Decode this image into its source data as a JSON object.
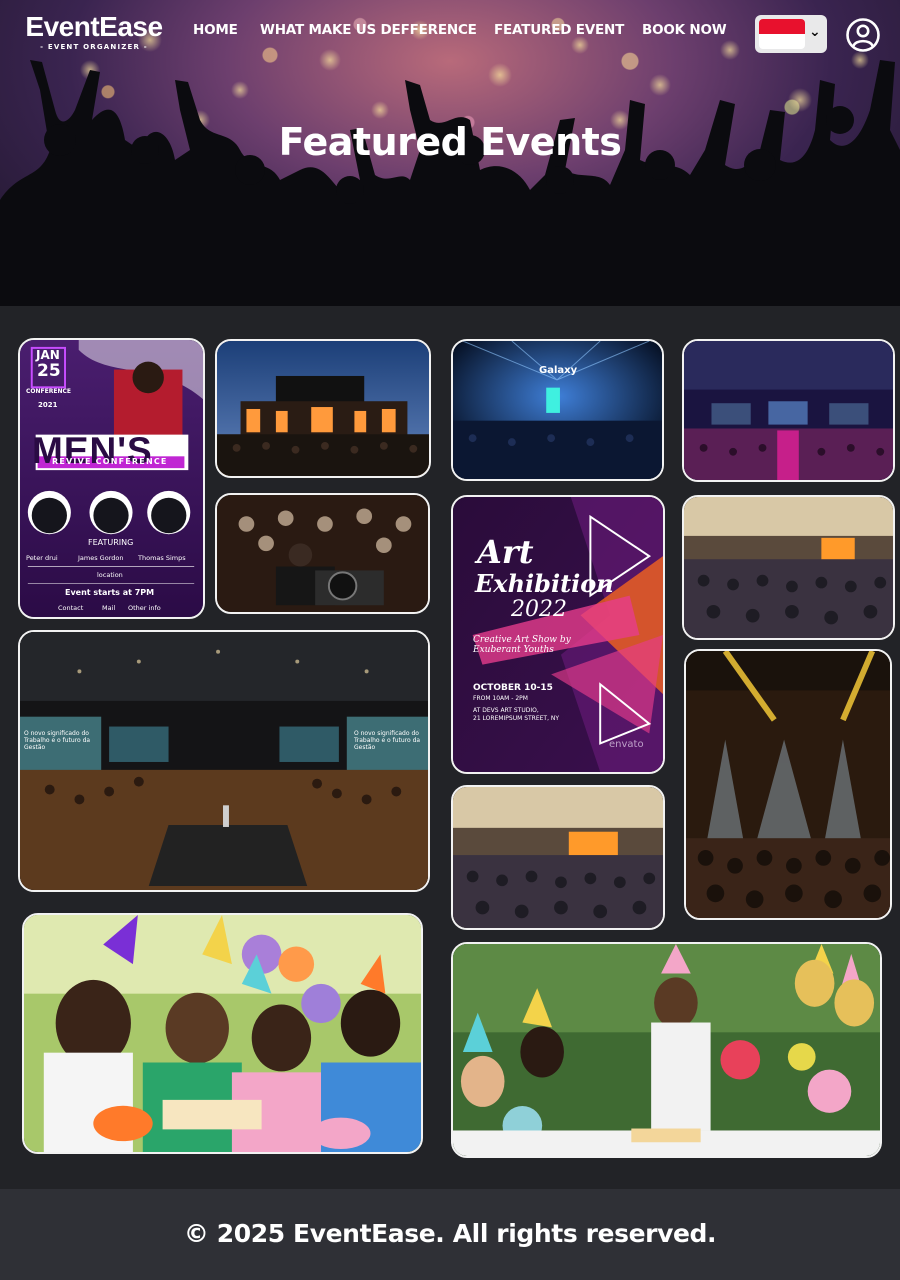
{
  "brand": {
    "name": "EventEase",
    "tagline": "- EVENT ORGANIZER -"
  },
  "nav": {
    "links": [
      {
        "label": "HOME"
      },
      {
        "label": "WHAT MAKE US DEFFERENCE"
      },
      {
        "label": "FEATURED EVENT"
      },
      {
        "label": "BOOK NOW"
      }
    ],
    "language_flag": "indonesia-flag-icon",
    "language_chevron": "⌄"
  },
  "hero": {
    "title": "Featured Events"
  },
  "gallery": {
    "posters": {
      "mens_conference": {
        "month": "JAN",
        "day": "25",
        "kind": "CONFERENCE",
        "year": "2021",
        "headline": "MEN'S",
        "banner": "REVIVE CONFERENCE",
        "featuring": "FEATURING",
        "speakers": [
          "Peter drui",
          "James Gordon",
          "Thomas Simps"
        ],
        "location": "location",
        "start": "Event starts at 7PM",
        "links": [
          "Contact",
          "Mail",
          "Other info"
        ]
      },
      "art_exhibition": {
        "line1": "Art",
        "line2": "Exhibition",
        "year": "2022",
        "subtitle": "Creative Art Show by Exuberant Youths",
        "dates": "OCTOBER 10-15",
        "time": "FROM 10AM - 2PM",
        "venue1": "AT DEVS ART STUDIO,",
        "venue2": "21 LOREMIPSUM STREET, NY",
        "watermark": "envato"
      },
      "galaxy_screen": "Galaxy",
      "stage_screen_left": "O novo significado do Trabalho e o futuro da Gestão",
      "stage_screen_right": "O novo significado do Trabalho e o futuro da Gestão"
    }
  },
  "footer": {
    "copyright": "© 2025 EventEase. All rights reserved."
  }
}
